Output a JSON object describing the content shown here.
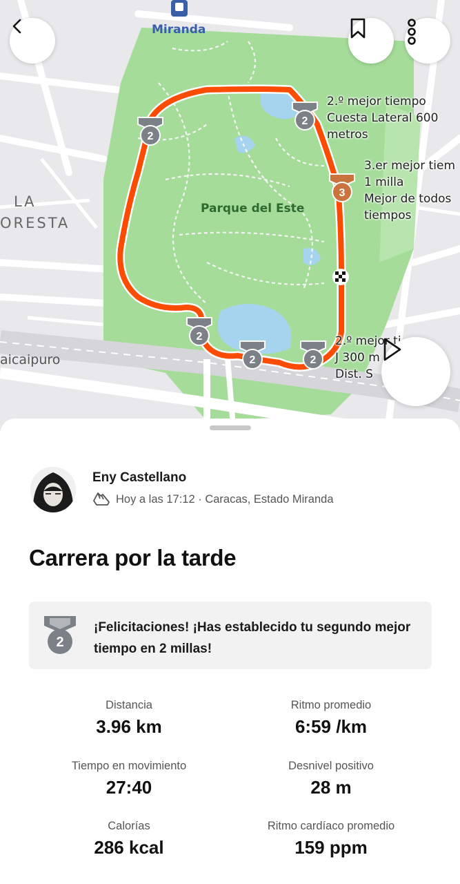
{
  "map": {
    "metro_label": "Miranda",
    "neighborhood_label_1": "LA",
    "neighborhood_label_2": "ORESTA",
    "park_label": "Parque del Este",
    "street_label": "aicaipuro",
    "segments": [
      {
        "line1": "2.º mejor tiempo",
        "line2": "Cuesta Lateral 600",
        "line3": "metros"
      },
      {
        "line1": "3.er mejor tiem",
        "line2": "1 milla",
        "line3": "Mejor de todos",
        "line4": "tiempos"
      },
      {
        "line1": "2.º mejor ti",
        "line2": "J 300 m",
        "line3": "Dist. S"
      }
    ],
    "route_color": "#fc4c02",
    "park_color": "#a5dc9a",
    "water_color": "#a6d4ee"
  },
  "buttons": {
    "back": "back-icon",
    "save": "bookmark-icon",
    "more": "more-vertical-icon",
    "play": "play-icon"
  },
  "activity": {
    "athlete_name": "Eny Castellano",
    "meta": "Hoy a las 17:12 · Caracas, Estado Miranda",
    "title": "Carrera por la tarde"
  },
  "achievement": {
    "rank": "2",
    "text": "¡Felicitaciones! ¡Has establecido tu segundo mejor tiempo en 2 millas!"
  },
  "stats": [
    {
      "label": "Distancia",
      "value": "3.96 km"
    },
    {
      "label": "Ritmo promedio",
      "value": "6:59 /km"
    },
    {
      "label": "Tiempo en movimiento",
      "value": "27:40"
    },
    {
      "label": "Desnivel positivo",
      "value": "28 m"
    },
    {
      "label": "Calorías",
      "value": "286 kcal"
    },
    {
      "label": "Ritmo cardíaco promedio",
      "value": "159 ppm"
    }
  ]
}
